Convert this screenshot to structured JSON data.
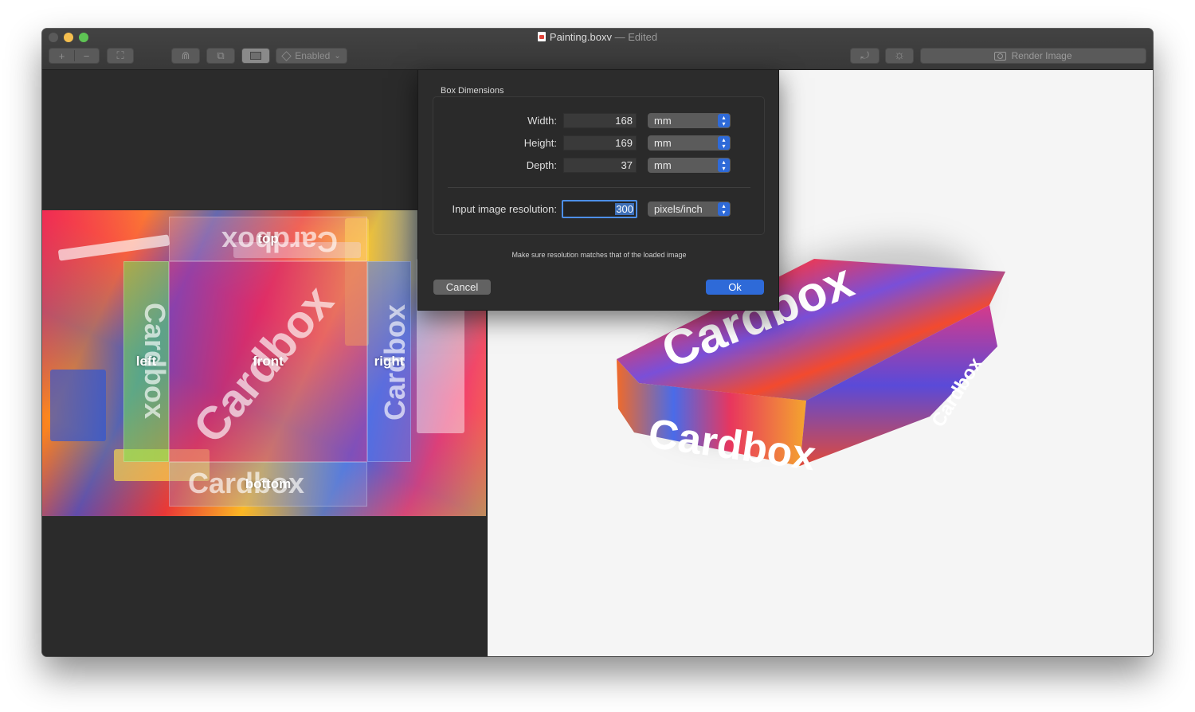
{
  "window": {
    "title": "Painting.boxv",
    "title_suffix": "— Edited"
  },
  "toolbar": {
    "add_glyph": "+",
    "remove_glyph": "−",
    "fit_glyph": "⛶",
    "magnet_glyph": "⋒",
    "flip_glyph": "⧉",
    "enabled_label": "Enabled",
    "enabled_chevron": "⌄",
    "rotate_glyph": "⤾",
    "light_glyph": "☼",
    "render_label": "Render Image"
  },
  "editor": {
    "regions": {
      "top": "top",
      "left": "left",
      "front": "front",
      "right": "right",
      "bottom": "bottom"
    },
    "texture_word": "Cardbox"
  },
  "preview": {
    "box_word": "Cardbox"
  },
  "dialog": {
    "group_title": "Box Dimensions",
    "width_label": "Width:",
    "width_value": "168",
    "width_unit": "mm",
    "height_label": "Height:",
    "height_value": "169",
    "height_unit": "mm",
    "depth_label": "Depth:",
    "depth_value": "37",
    "depth_unit": "mm",
    "resolution_label": "Input image resolution:",
    "resolution_value": "300",
    "resolution_unit": "pixels/inch",
    "hint": "Make sure resolution matches that of the loaded image",
    "cancel_label": "Cancel",
    "ok_label": "Ok"
  },
  "colors": {
    "accent": "#2e6ad8",
    "window_bg": "#2b2b2b",
    "preview_bg": "#f5f5f5"
  }
}
